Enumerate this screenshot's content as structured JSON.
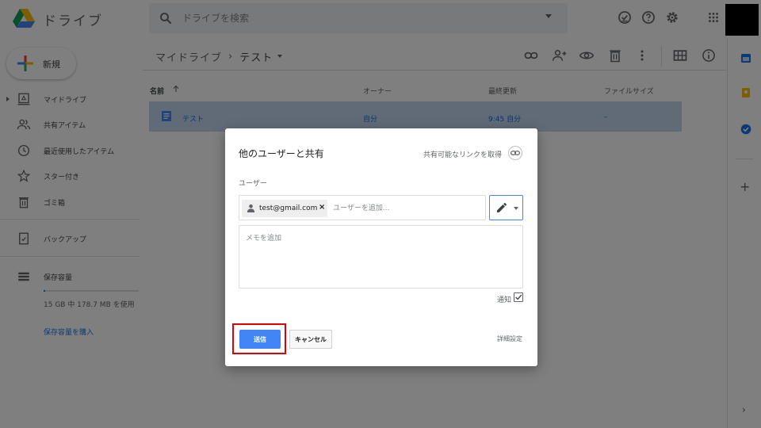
{
  "header": {
    "app_title": "ドライブ",
    "search_placeholder": "ドライブを検索"
  },
  "new_button": {
    "label": "新規"
  },
  "breadcrumb": {
    "root": "マイドライブ",
    "separator": "›",
    "current": "テスト"
  },
  "sidebar": {
    "items": [
      {
        "label": "マイドライブ",
        "icon": "my-drive-icon"
      },
      {
        "label": "共有アイテム",
        "icon": "shared-icon"
      },
      {
        "label": "最近使用したアイテム",
        "icon": "recent-icon"
      },
      {
        "label": "スター付き",
        "icon": "star-icon"
      },
      {
        "label": "ゴミ箱",
        "icon": "trash-icon"
      },
      {
        "label": "バックアップ",
        "icon": "backup-icon"
      },
      {
        "label": "保存容量",
        "icon": "storage-icon"
      }
    ],
    "storage_used_fraction": 0.012,
    "storage_text": "15 GB 中 178.7 MB を使用",
    "storage_buy": "保存容量を購入"
  },
  "file_list": {
    "columns": {
      "name": "名前",
      "owner": "オーナー",
      "modified": "最終更新",
      "size": "ファイルサイズ"
    },
    "rows": [
      {
        "name": "テスト",
        "owner": "自分",
        "modified": "9:45 自分",
        "size": "–"
      }
    ]
  },
  "dialog": {
    "title": "他のユーザーと共有",
    "share_link_label": "共有可能なリンクを取得",
    "users_label": "ユーザー",
    "chip_email": "test@gmail.com",
    "chip_close": "×",
    "add_user_placeholder": "ユーザーを追加...",
    "note_placeholder": "メモを追加",
    "notify_label": "通知",
    "notify_checked": true,
    "send_label": "送信",
    "cancel_label": "キャンセル",
    "advanced_label": "詳細設定"
  },
  "colors": {
    "accent": "#4285f4",
    "selected_row": "#c2d7f1",
    "highlight": "#e00000"
  }
}
